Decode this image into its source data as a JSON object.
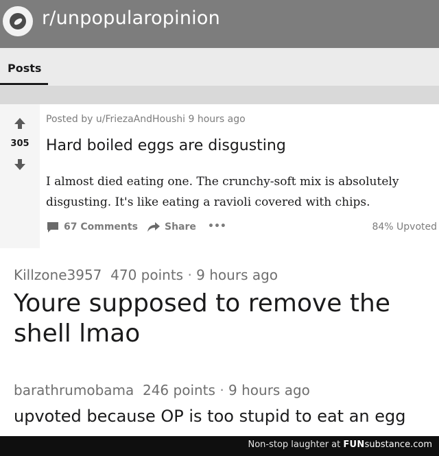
{
  "header": {
    "subreddit": "r/unpopularopinion",
    "logo_icon": "reddit-logo-icon"
  },
  "tabs": [
    {
      "label": "Posts",
      "active": true
    }
  ],
  "post": {
    "score": "305",
    "posted_by": "Posted by u/FriezaAndHoushi 9 hours ago",
    "title": "Hard boiled eggs are disgusting",
    "body_line1": "I almost died eating one. The crunchy-soft mix is absolutely",
    "body_line2": "disgusting. It's like eating a ravioli covered with chips.",
    "comments_label": "67 Comments",
    "share_label": "Share",
    "more_label": "•••",
    "upvoted_label": "84% Upvoted"
  },
  "comments": [
    {
      "user": "Killzone3957",
      "points": "470 points",
      "sep": "·",
      "time": "9 hours ago",
      "text": "Youre supposed to remove the shell lmao"
    },
    {
      "user": "barathrumobama",
      "points": "246 points",
      "sep": "·",
      "time": "9 hours ago",
      "text": "upvoted because OP is too stupid to eat an egg"
    }
  ],
  "footer": {
    "tagline": "Non-stop laughter at",
    "brand_bold": "FUN",
    "brand_rest": "substance",
    "brand_suffix": ".com"
  },
  "colors": {
    "header_bg": "#7d7d7d",
    "arrow": "#5a5a5a",
    "muted_text": "#7c7c7c"
  }
}
